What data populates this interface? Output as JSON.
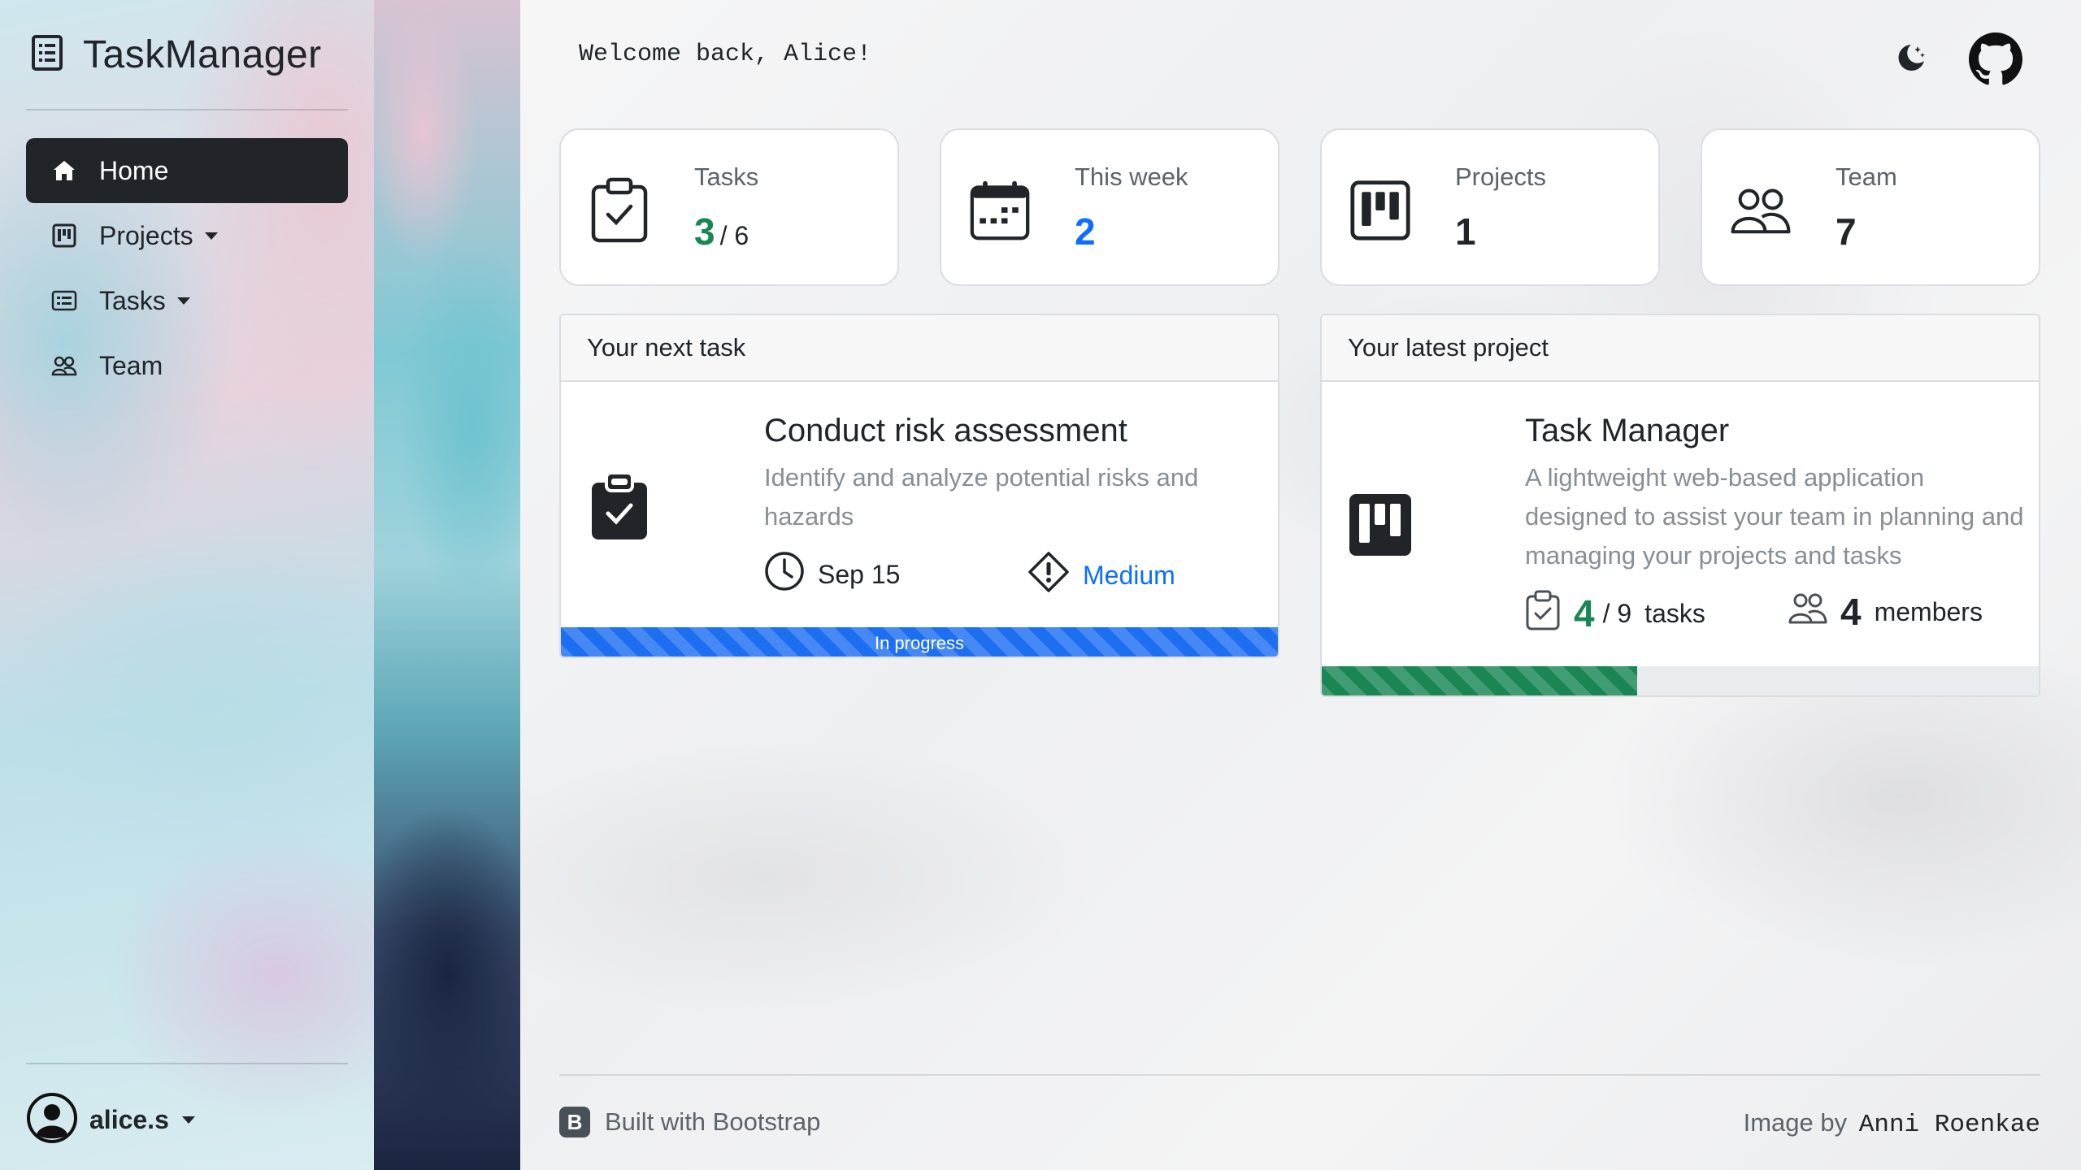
{
  "app": {
    "title": "TaskManager"
  },
  "sidebar": {
    "items": [
      {
        "label": "Home",
        "icon": "house-icon",
        "active": true
      },
      {
        "label": "Projects",
        "icon": "kanban-icon",
        "dropdown": true
      },
      {
        "label": "Tasks",
        "icon": "card-checklist-icon",
        "dropdown": true
      },
      {
        "label": "Team",
        "icon": "people-icon"
      }
    ],
    "user": {
      "name": "alice.s"
    }
  },
  "header": {
    "welcome": "Welcome back, Alice!"
  },
  "stats": {
    "tasks": {
      "label": "Tasks",
      "value": "3",
      "total": "/ 6",
      "color": "#198754"
    },
    "week": {
      "label": "This week",
      "value": "2",
      "color": "#0d6efd"
    },
    "projects": {
      "label": "Projects",
      "value": "1"
    },
    "team": {
      "label": "Team",
      "value": "7"
    }
  },
  "next_task": {
    "heading": "Your next task",
    "title": "Conduct risk assessment",
    "description": "Identify and analyze potential risks and hazards",
    "due": "Sep 15",
    "priority": "Medium",
    "priority_color": "#0d6efd",
    "status": "In progress"
  },
  "latest_project": {
    "heading": "Your latest project",
    "title": "Task Manager",
    "description": "A lightweight web-based application designed to assist your team in planning and managing your projects and tasks",
    "tasks_done": "4",
    "tasks_total": "/ 9",
    "tasks_label": "tasks",
    "members": "4",
    "members_label": "members",
    "progress": 0.44,
    "progress_color": "#198754"
  },
  "footer": {
    "built": "Built with Bootstrap",
    "badge": "B",
    "credit_prefix": "Image by",
    "credit_author": "Anni Roenkae"
  }
}
